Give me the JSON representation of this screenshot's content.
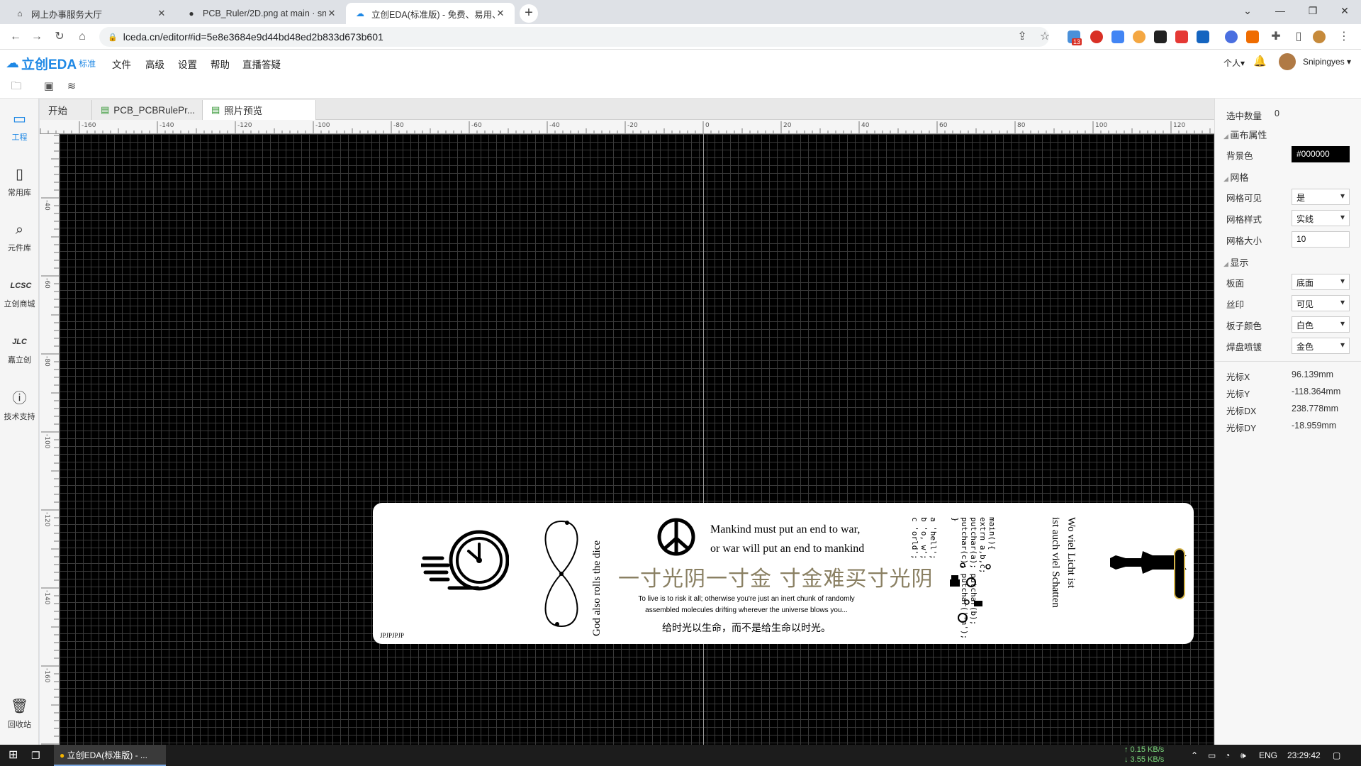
{
  "browser": {
    "tabs": [
      {
        "title": "网上办事服务大厅",
        "icon": "home-icon"
      },
      {
        "title": "PCB_Ruler/2D.png at main · sn",
        "icon": "github-icon"
      },
      {
        "title": "立创EDA(标准版) - 免费、易用、",
        "icon": "lceda-icon"
      }
    ],
    "url": "lceda.cn/editor#id=5e8e3684e9d44bd48ed2b833d673b601",
    "extension_badge": "13"
  },
  "app": {
    "logo_text": "立创EDA",
    "logo_sub": "标准",
    "menu": [
      "文件",
      "高级",
      "设置",
      "帮助",
      "直播答疑"
    ],
    "personal": "个人▾",
    "username": "Snipingyes ▾"
  },
  "sidebar": [
    {
      "label": "工程",
      "icon": "project-icon"
    },
    {
      "label": "常用库",
      "icon": "library-icon"
    },
    {
      "label": "元件库",
      "icon": "component-search-icon"
    },
    {
      "label": "立创商城",
      "icon": "lcsc-icon"
    },
    {
      "label": "嘉立创",
      "icon": "jlc-icon"
    },
    {
      "label": "技术支持",
      "icon": "help-icon"
    },
    {
      "label": "回收站",
      "icon": "trash-icon"
    }
  ],
  "doc_tabs": [
    "开始",
    "PCB_PCBRulePr...",
    "照片预览"
  ],
  "ruler": {
    "h_labels": [
      "-160",
      "-140",
      "-120",
      "-100",
      "-80",
      "-60",
      "-40",
      "-20",
      "0",
      "20",
      "40",
      "60",
      "80",
      "100",
      "120"
    ],
    "v_labels": [
      "-40",
      "-60",
      "-80",
      "-100",
      "-120",
      "-140",
      "-160"
    ]
  },
  "board": {
    "quote_en": [
      "Mankind must put an end to war,",
      "or war will put an end to mankind"
    ],
    "quote_cn": "一寸光阴一寸金 寸金难买寸光阴",
    "small_en": [
      "To live is to risk it all; otherwise you're just an inert chunk of randomly",
      "assembled molecules drifting wherever the universe blows you..."
    ],
    "quote_cn2": "给时光以生命，而不是给生命以时光。",
    "dice": "God also rolls the dice",
    "code": [
      "main(){",
      "extrn a,b,c;",
      "putchar(a); putchar(b);",
      "putchar(c); putchar('*n');",
      "}",
      "a 'hell';",
      "b 'o, w';",
      "c 'orld';"
    ],
    "german": [
      "Wo viel Licht ist",
      "ist auch viel Schatten"
    ],
    "marker": "JPJPJPJP"
  },
  "properties": {
    "selected_count_label": "选中数量",
    "selected_count": "0",
    "canvas_section": "画布属性",
    "bg_label": "背景色",
    "bg_value": "#000000",
    "grid_section": "网格",
    "grid_visible_label": "网格可见",
    "grid_visible": "是",
    "grid_style_label": "网格样式",
    "grid_style": "实线",
    "grid_size_label": "网格大小",
    "grid_size": "10",
    "display_section": "显示",
    "layer_label": "板面",
    "layer": "底面",
    "silk_label": "丝印",
    "silk": "可见",
    "board_color_label": "板子颜色",
    "board_color": "白色",
    "pad_label": "焊盘喷镀",
    "pad": "金色",
    "cursor_x_label": "光标X",
    "cursor_x": "96.139mm",
    "cursor_y_label": "光标Y",
    "cursor_y": "-118.364mm",
    "cursor_dx_label": "光标DX",
    "cursor_dx": "238.778mm",
    "cursor_dy_label": "光标DY",
    "cursor_dy": "-18.959mm"
  },
  "taskbar": {
    "app": "立创EDA(标准版) - ...",
    "net_up": "↑ 0.15 KB/s",
    "net_down": "↓ 3.55 KB/s",
    "lang": "ENG",
    "time": "23:29:42"
  }
}
